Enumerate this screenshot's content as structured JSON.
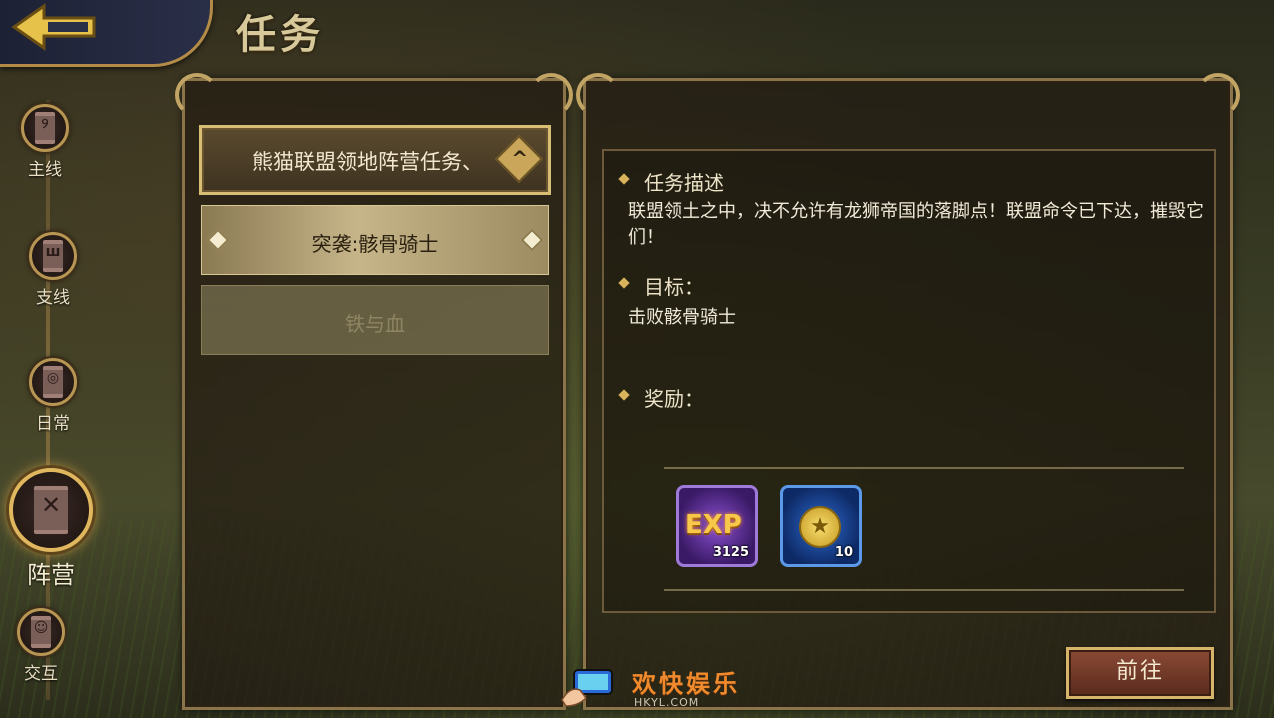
{
  "header": {
    "title": "任务"
  },
  "sidebar": {
    "items": [
      {
        "label": "主线",
        "glyph": "୨",
        "active": false
      },
      {
        "label": "支线",
        "glyph": "ш",
        "active": false
      },
      {
        "label": "日常",
        "glyph": "◎",
        "active": false
      },
      {
        "label": "阵营",
        "glyph": "✕",
        "active": true
      },
      {
        "label": "交互",
        "glyph": "☺",
        "active": false
      }
    ]
  },
  "quest_list": {
    "category": "熊猫联盟领地阵营任务、",
    "items": [
      {
        "label": "突袭:骸骨骑士",
        "selected": true
      },
      {
        "label": "铁与血",
        "selected": false
      }
    ]
  },
  "detail": {
    "description_title": "任务描述",
    "description": "联盟领土之中，决不允许有龙狮帝国的落脚点！联盟命令已下达，摧毁它们！",
    "target_title": "目标：",
    "target": "击败骸骨骑士",
    "reward_title": "奖励：",
    "rewards": [
      {
        "icon": "exp-icon",
        "label": "EXP",
        "count": "3125"
      },
      {
        "icon": "medal-coin-icon",
        "label": "★",
        "count": "10"
      }
    ],
    "go_button": "前往"
  },
  "watermark": {
    "text": "欢快娱乐",
    "url": "HKYL.COM"
  },
  "colors": {
    "gold": "#c2a464",
    "accent_orange": "#f08a2c",
    "exp_purple": "#8a4fd0",
    "medal_blue": "#2d6ad0"
  }
}
